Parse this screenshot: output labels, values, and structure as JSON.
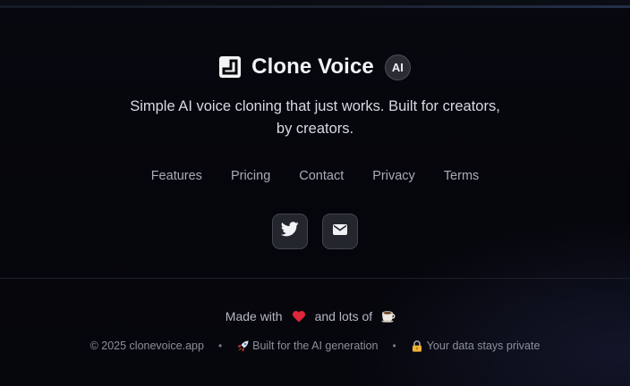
{
  "brand": {
    "name": "Clone Voice",
    "badge": "AI"
  },
  "tagline": "Simple AI voice cloning that just works. Built for creators, by creators.",
  "nav": {
    "features": "Features",
    "pricing": "Pricing",
    "contact": "Contact",
    "privacy": "Privacy",
    "terms": "Terms"
  },
  "social": {
    "twitter_icon": "twitter-icon",
    "email_icon": "mail-icon"
  },
  "footer": {
    "made_with_prefix": "Made with",
    "made_with_heart_icon": "heart-icon",
    "made_with_middle": "and lots of",
    "made_with_coffee_icon": "coffee-icon",
    "copyright": "© 2025 clonevoice.app",
    "separator": "•",
    "built_for": "Built for the AI generation",
    "built_for_icon": "rocket-icon",
    "privacy_note": "Your data stays private",
    "privacy_note_icon": "lock-icon"
  },
  "colors": {
    "background": "#05060b",
    "heart": "#e0263a",
    "text_primary": "#f2f3f6",
    "text_muted": "#8b8f9b"
  }
}
